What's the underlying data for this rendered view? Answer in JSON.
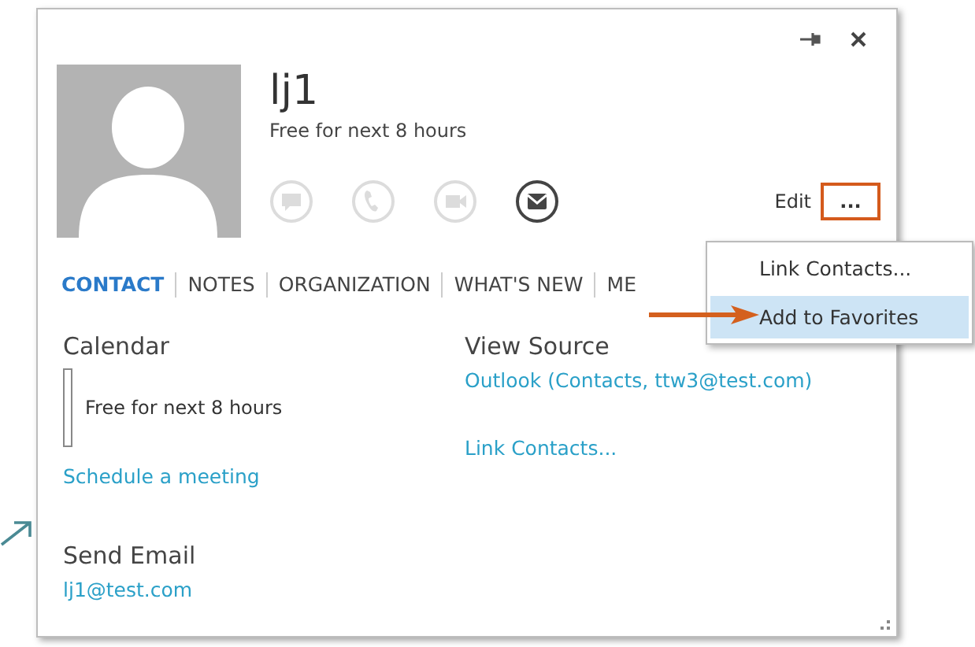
{
  "window": {
    "title_controls": [
      {
        "kind": "pin"
      },
      {
        "kind": "close"
      }
    ]
  },
  "contact": {
    "name": "lj1",
    "status": "Free for next 8 hours"
  },
  "actions": [
    {
      "kind": "im",
      "disabled": true
    },
    {
      "kind": "call",
      "disabled": true
    },
    {
      "kind": "video",
      "disabled": true
    },
    {
      "kind": "mail",
      "disabled": false
    }
  ],
  "edit_label": "Edit",
  "more_button": {
    "label": "...",
    "highlighted": true
  },
  "tabs": [
    {
      "label": "CONTACT",
      "selected": true
    },
    {
      "label": "NOTES",
      "selected": false
    },
    {
      "label": "ORGANIZATION",
      "selected": false
    },
    {
      "label": "WHAT'S NEW",
      "selected": false
    },
    {
      "label": "ME",
      "selected": false
    }
  ],
  "menu": [
    {
      "label": "Link Contacts...",
      "selected": false
    },
    {
      "label": "Add to Favorites",
      "selected": true
    }
  ],
  "calendar": {
    "heading": "Calendar",
    "status": "Free for next 8 hours",
    "link": "Schedule a meeting"
  },
  "send_email": {
    "heading": "Send Email",
    "address": "lj1@test.com"
  },
  "view_source": {
    "heading": "View Source",
    "source": "Outlook (Contacts, ttw3@test.com)",
    "link": "Link Contacts..."
  }
}
